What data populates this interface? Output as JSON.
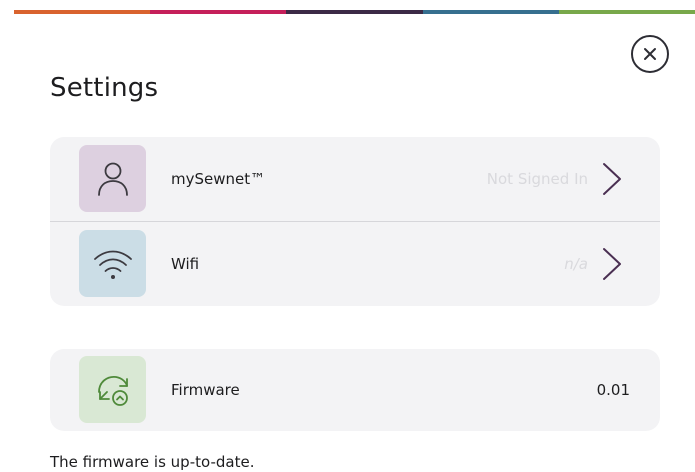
{
  "stripe_colors": [
    "#d9632e",
    "#c51f5a",
    "#3c2a46",
    "#366f8f",
    "#78a84a"
  ],
  "header": {
    "title": "Settings",
    "close_icon": "close-icon"
  },
  "settings": {
    "items": [
      {
        "label": "mySewnet™",
        "value": "Not Signed In",
        "icon": "user-icon",
        "icon_bg": "#ddd0e0"
      },
      {
        "label": "Wifi",
        "value": "n/a",
        "icon": "wifi-icon",
        "icon_bg": "#cbdde6"
      }
    ]
  },
  "firmware": {
    "label": "Firmware",
    "value": "0.01",
    "icon": "firmware-update-icon",
    "icon_bg": "#d9e8d4"
  },
  "status": {
    "message": "The firmware is up-to-date."
  },
  "colors": {
    "card_bg": "#f3f3f5",
    "chevron": "#4a2f52",
    "muted_text": "#d9d9dd"
  }
}
